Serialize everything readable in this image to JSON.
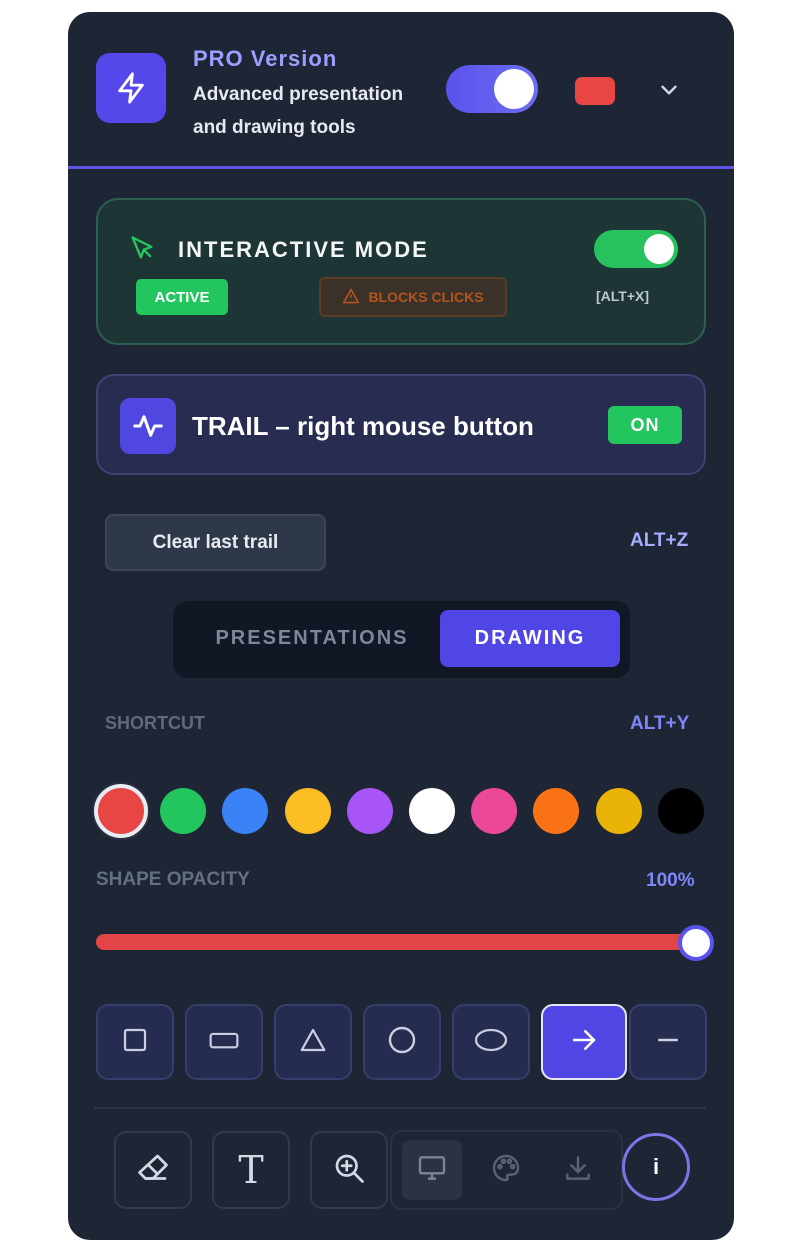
{
  "header": {
    "title": "PRO Version",
    "subtitle": "Advanced presentation and drawing tools",
    "icon": "bolt-icon",
    "pro_enabled": true,
    "color_chip": "#e84545",
    "chevron_icon": "chevron-down-icon"
  },
  "interactive": {
    "title": "INTERACTIVE MODE",
    "icon": "cursor-arrow-icon",
    "enabled": true,
    "status_badge": "ACTIVE",
    "warning_badge": "BLOCKS CLICKS",
    "warning_icon": "warning-triangle-icon",
    "shortcut": "[ALT+X]"
  },
  "trail": {
    "icon": "activity-wave-icon",
    "label": "TRAIL – right mouse button",
    "status": "ON"
  },
  "clear": {
    "label": "Clear last trail",
    "shortcut": "ALT+Z"
  },
  "tabs": [
    {
      "label": "PRESENTATIONS",
      "active": false
    },
    {
      "label": "DRAWING",
      "active": true
    }
  ],
  "shortcut": {
    "label": "SHORTCUT",
    "value": "ALT+Y"
  },
  "colors": [
    {
      "name": "red",
      "hex": "#e84545",
      "selected": true
    },
    {
      "name": "green",
      "hex": "#22c55e",
      "selected": false
    },
    {
      "name": "blue",
      "hex": "#3b82f6",
      "selected": false
    },
    {
      "name": "yellow",
      "hex": "#fbbf24",
      "selected": false
    },
    {
      "name": "purple",
      "hex": "#a855f7",
      "selected": false
    },
    {
      "name": "white",
      "hex": "#ffffff",
      "selected": false
    },
    {
      "name": "pink",
      "hex": "#ec4899",
      "selected": false
    },
    {
      "name": "orange",
      "hex": "#f97316",
      "selected": false
    },
    {
      "name": "gold",
      "hex": "#eab308",
      "selected": false
    },
    {
      "name": "black",
      "hex": "#000000",
      "selected": false
    }
  ],
  "opacity": {
    "label": "SHAPE OPACITY",
    "value_text": "100%",
    "value": 1.0
  },
  "shapes": [
    {
      "name": "square-icon",
      "active": false
    },
    {
      "name": "rectangle-icon",
      "active": false
    },
    {
      "name": "triangle-icon",
      "active": false
    },
    {
      "name": "circle-icon",
      "active": false
    },
    {
      "name": "ellipse-icon",
      "active": false
    },
    {
      "name": "arrow-right-icon",
      "active": true
    },
    {
      "name": "line-icon",
      "active": false
    }
  ],
  "tools": [
    {
      "name": "eraser-icon"
    },
    {
      "name": "text-icon",
      "glyph": "T"
    },
    {
      "name": "zoom-in-icon"
    }
  ],
  "group_tools": [
    {
      "name": "monitor-icon",
      "active": true
    },
    {
      "name": "palette-icon",
      "active": false
    },
    {
      "name": "download-icon",
      "active": false
    }
  ],
  "info": {
    "glyph": "i",
    "icon": "info-icon"
  }
}
